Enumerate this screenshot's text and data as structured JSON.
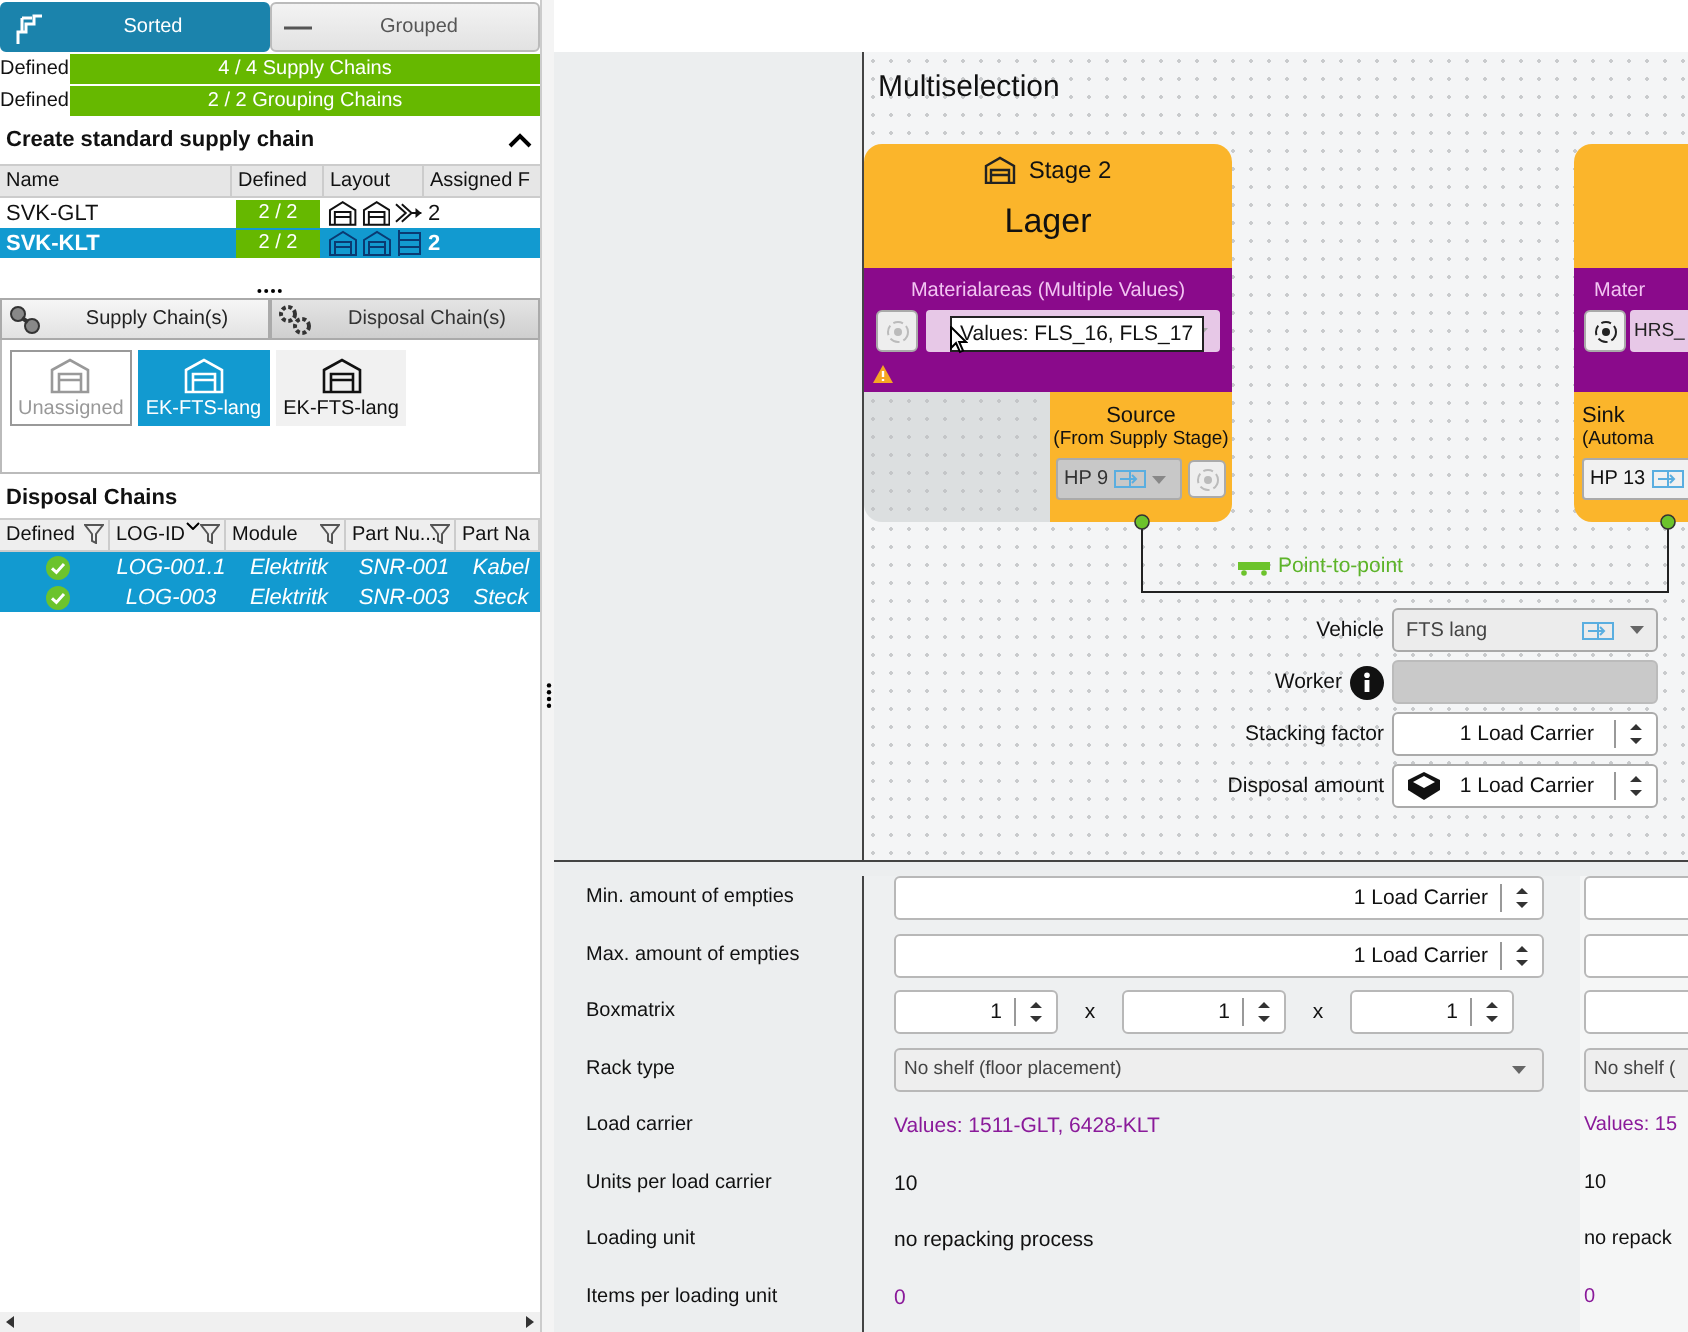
{
  "view_toggle": [
    {
      "label": "Sorted",
      "selected": true
    },
    {
      "label": "Grouped",
      "selected": false
    }
  ],
  "summary": [
    {
      "label": "Defined",
      "bar": "4 / 4 Supply Chains"
    },
    {
      "label": "Defined",
      "bar": "2 / 2 Grouping Chains"
    }
  ],
  "supply_section": {
    "title": "Create standard supply chain",
    "expanded": true,
    "columns": [
      "Name",
      "Defined",
      "Layout",
      "Assigned F"
    ],
    "rows": [
      {
        "name": "SVK-GLT",
        "defined": "2 / 2",
        "layout": [
          {
            "kind": "stage"
          },
          {
            "kind": "stage"
          },
          {
            "kind": "merge"
          }
        ],
        "assigned": "2",
        "selected": false
      },
      {
        "name": "SVK-KLT",
        "defined": "2 / 2",
        "layout": [
          {
            "kind": "stage"
          },
          {
            "kind": "stage"
          },
          {
            "kind": "rack"
          }
        ],
        "assigned": "2",
        "selected": true
      }
    ]
  },
  "chain_tabs": [
    {
      "label": "Supply Chain(s)",
      "kind": "supply",
      "selected": true
    },
    {
      "label": "Disposal Chain(s)",
      "kind": "disposal",
      "selected": false
    }
  ],
  "stage_tiles": [
    {
      "label": "Unassigned",
      "selected": false,
      "disabled": true
    },
    {
      "label": "EK-FTS-lang",
      "selected": true,
      "disabled": false
    },
    {
      "label": "EK-FTS-lang",
      "selected": false,
      "disabled": false
    }
  ],
  "disposal": {
    "title": "Disposal Chains",
    "columns": [
      {
        "label": "Defined",
        "filter": true,
        "sorted": false
      },
      {
        "label": "LOG-ID",
        "filter": true,
        "sorted": true
      },
      {
        "label": "Module",
        "filter": true,
        "sorted": false
      },
      {
        "label": "Part Nu...",
        "filter": true,
        "sorted": false
      },
      {
        "label": "Part Na",
        "filter": false,
        "sorted": false
      }
    ],
    "rows": [
      {
        "defined": true,
        "log_id": "LOG-001.1",
        "module": "Elektritk",
        "part_number": "SNR-001",
        "part_name": "Kabel",
        "selected": true
      },
      {
        "defined": true,
        "log_id": "LOG-003",
        "module": "Elektritk",
        "part_number": "SNR-003",
        "part_name": "Steck",
        "selected": true
      }
    ]
  },
  "canvas": {
    "title": "Multiselection",
    "stages": [
      {
        "stage_label": "Stage 2",
        "name": "Lager",
        "area": {
          "title": "Materialareas (Multiple Values)",
          "tooltip": "Values: FLS_16, FLS_17",
          "radio_enabled": false,
          "warning": true
        },
        "endpoint": {
          "kind": "source",
          "title": "Source",
          "subtitle": "(From Supply Stage)",
          "value": "HP 9",
          "disabled": true,
          "radio_enabled": false
        }
      },
      {
        "area": {
          "title": "Mater",
          "value": "HRS_",
          "radio_enabled": true,
          "warning": false
        },
        "endpoint": {
          "kind": "sink",
          "title": "Sink",
          "subtitle": "(Automa",
          "value": "HP 13",
          "disabled": false
        }
      }
    ],
    "connection": {
      "label": "Point-to-point"
    },
    "transport": [
      {
        "label": "Vehicle",
        "kind": "select",
        "value": "FTS lang"
      },
      {
        "label": "Worker",
        "kind": "info"
      },
      {
        "label": "Stacking factor",
        "kind": "spin",
        "value": "1 Load Carrier"
      },
      {
        "label": "Disposal amount",
        "kind": "amount",
        "value": "1 Load Carrier"
      }
    ]
  },
  "properties": [
    {
      "label": "Min. amount of empties",
      "kind": "spin",
      "cells": [
        {
          "value": "1 Load Carrier"
        },
        {}
      ]
    },
    {
      "label": "Max. amount of empties",
      "kind": "spin",
      "cells": [
        {
          "value": "1 Load Carrier"
        },
        {}
      ]
    },
    {
      "label": "Boxmatrix",
      "kind": "matrix",
      "cells": [
        {
          "values": [
            "1",
            "1",
            "1"
          ],
          "separators": [
            "x",
            "x"
          ]
        },
        {}
      ]
    },
    {
      "label": "Rack type",
      "kind": "select",
      "cells": [
        {
          "value": "No shelf (floor placement)"
        },
        {
          "value": "No shelf ("
        }
      ]
    },
    {
      "label": "Load carrier",
      "kind": "mixed",
      "cells": [
        {
          "value": "Values: 1511-GLT, 6428-KLT"
        },
        {
          "value": "Values: 15"
        }
      ]
    },
    {
      "label": "Units per load carrier",
      "kind": "text",
      "cells": [
        {
          "value": "10"
        },
        {
          "value": "10"
        }
      ]
    },
    {
      "label": "Loading unit",
      "kind": "text",
      "cells": [
        {
          "value": "no repacking process"
        },
        {
          "value": "no repack"
        }
      ]
    },
    {
      "label": "Items per loading unit",
      "kind": "mixed",
      "cells": [
        {
          "value": "0"
        },
        {
          "value": "0"
        }
      ]
    }
  ]
}
